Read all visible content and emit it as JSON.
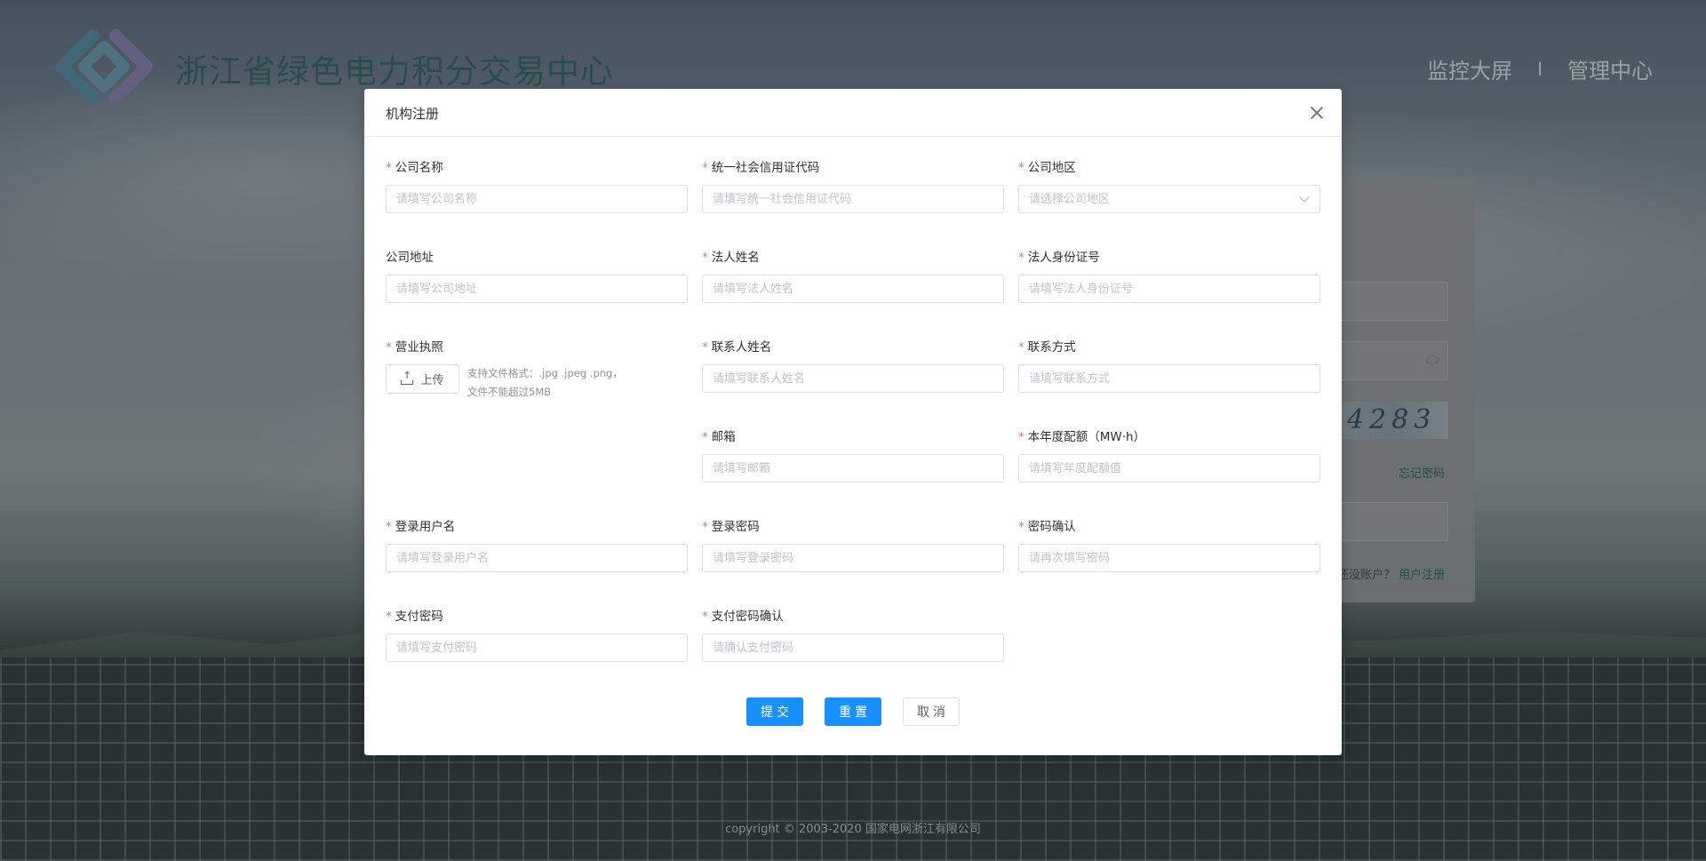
{
  "header": {
    "site_title": "浙江省绿色电力积分交易中心",
    "nav": [
      "监控大屏",
      "管理中心"
    ],
    "nav_separator": "I"
  },
  "login_card": {
    "captcha_text": "4283",
    "forgot_password": "忘记密码",
    "no_account_prefix": "还没账户？",
    "register_link": "用户注册"
  },
  "footer": {
    "copyright": "copyright © 2003-2020 国家电网浙江有限公司"
  },
  "modal": {
    "title": "机构注册",
    "fields": {
      "company_name": {
        "label": "公司名称",
        "required": true,
        "placeholder": "请填写公司名称"
      },
      "credit_code": {
        "label": "统一社会信用证代码",
        "required": true,
        "placeholder": "请填写统一社会信用证代码"
      },
      "region": {
        "label": "公司地区",
        "required": true,
        "placeholder": "请选择公司地区"
      },
      "address": {
        "label": "公司地址",
        "required": false,
        "placeholder": "请填写公司地址"
      },
      "legal_name": {
        "label": "法人姓名",
        "required": true,
        "placeholder": "请填写法人姓名"
      },
      "legal_id": {
        "label": "法人身份证号",
        "required": true,
        "placeholder": "请填写法人身份证号"
      },
      "license": {
        "label": "营业执照",
        "required": true,
        "upload_label": "上传",
        "tip_line1": "支持文件格式：.jpg .jpeg .png，",
        "tip_line2": "文件不能超过5MB"
      },
      "contact_name": {
        "label": "联系人姓名",
        "required": true,
        "placeholder": "请填写联系人姓名"
      },
      "contact_phone": {
        "label": "联系方式",
        "required": true,
        "placeholder": "请填写联系方式"
      },
      "email": {
        "label": "邮箱",
        "required": true,
        "placeholder": "请填写邮箱"
      },
      "quota": {
        "label": "本年度配额（MW·h）",
        "required": true,
        "placeholder": "请填写年度配额值"
      },
      "username": {
        "label": "登录用户名",
        "required": true,
        "placeholder": "请填写登录用户名"
      },
      "password": {
        "label": "登录密码",
        "required": true,
        "placeholder": "请填写登录密码"
      },
      "password_confirm": {
        "label": "密码确认",
        "required": true,
        "placeholder": "请再次填写密码"
      },
      "pay_password": {
        "label": "支付密码",
        "required": true,
        "placeholder": "请填写支付密码"
      },
      "pay_password_confirm": {
        "label": "支付密码确认",
        "required": true,
        "placeholder": "请确认支付密码"
      }
    },
    "buttons": {
      "submit": "提交",
      "reset": "重置",
      "cancel": "取消"
    }
  },
  "colors": {
    "primary": "#1890ff",
    "required": "#f56c6c",
    "link": "#2f6e64"
  }
}
